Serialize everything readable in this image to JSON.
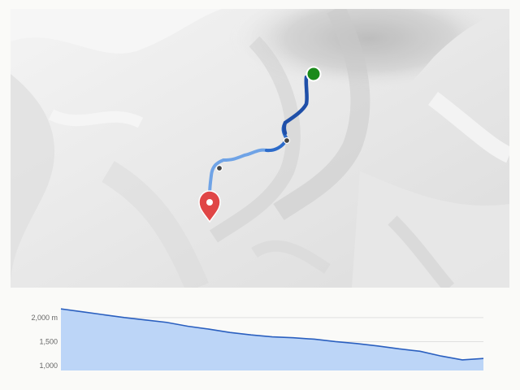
{
  "map": {
    "route_color": "#1f4fa8",
    "route_light_color": "#6fa3e6",
    "start_marker": {
      "icon": "start-dot-icon",
      "color": "#1a8a1a"
    },
    "end_marker": {
      "icon": "map-pin-icon",
      "color": "#e04646"
    },
    "waypoints": 2
  },
  "elevation_profile": {
    "chart_data": {
      "type": "area",
      "title": "",
      "xlabel": "",
      "ylabel": "",
      "y_tick_labels": [
        "2,000 m",
        "1,500",
        "1,000"
      ],
      "y_ticks": [
        2000,
        1500,
        1000
      ],
      "ylim": [
        900,
        2250
      ],
      "x": [
        0,
        0.05,
        0.1,
        0.15,
        0.2,
        0.25,
        0.3,
        0.35,
        0.4,
        0.45,
        0.5,
        0.55,
        0.6,
        0.65,
        0.7,
        0.75,
        0.8,
        0.85,
        0.9,
        0.95,
        1.0
      ],
      "values": [
        2180,
        2120,
        2060,
        2000,
        1950,
        1900,
        1820,
        1760,
        1690,
        1640,
        1600,
        1580,
        1550,
        1500,
        1460,
        1410,
        1350,
        1300,
        1200,
        1120,
        1150
      ],
      "fill_color": "#bcd5f7",
      "line_color": "#2a5fbf",
      "grid": true
    }
  }
}
